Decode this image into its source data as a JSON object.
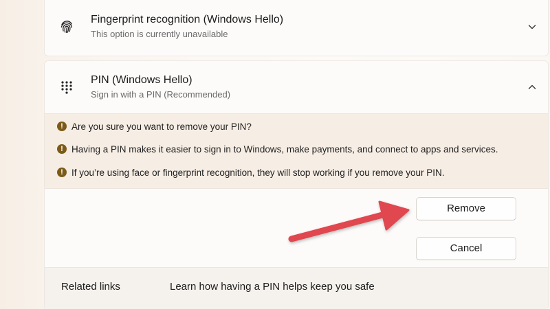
{
  "fingerprint": {
    "title": "Fingerprint recognition (Windows Hello)",
    "subtitle": "This option is currently unavailable",
    "icon": "fingerprint-icon",
    "expanded": false
  },
  "pin": {
    "title": "PIN (Windows Hello)",
    "subtitle": "Sign in with a PIN (Recommended)",
    "icon": "pin-keypad-icon",
    "expanded": true,
    "warnings": [
      "Are you sure you want to remove your PIN?",
      "Having a PIN makes it easier to sign in to Windows, make payments, and connect to apps and services.",
      "If you’re using face or fingerprint recognition, they will stop working if you remove your PIN."
    ],
    "warning_badge": "!",
    "remove_label": "Remove",
    "cancel_label": "Cancel"
  },
  "related": {
    "label": "Related links",
    "link": "Learn how having a PIN helps keep you safe"
  },
  "colors": {
    "warning_badge": "#7c5b18",
    "arrow": "#e0474f"
  }
}
